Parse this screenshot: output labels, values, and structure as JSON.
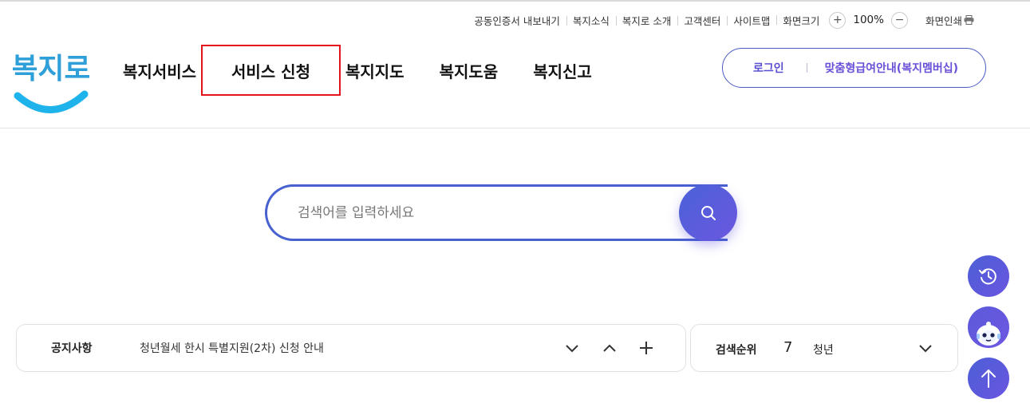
{
  "utility": {
    "cert_export": "공동인증서 내보내기",
    "news": "복지소식",
    "about": "복지로 소개",
    "customer": "고객센터",
    "sitemap": "사이트맵",
    "screen_size": "화면크기",
    "zoom_plus": "+",
    "zoom_value": "100%",
    "zoom_minus": "−",
    "print": "화면인쇄"
  },
  "logo": {
    "text": "복지로"
  },
  "nav": {
    "items": [
      {
        "label": "복지서비스"
      },
      {
        "label": "서비스 신청"
      },
      {
        "label": "복지지도"
      },
      {
        "label": "복지도움"
      },
      {
        "label": "복지신고"
      }
    ]
  },
  "auth": {
    "login": "로그인",
    "membership": "맞춤형급여안내(복지멤버십)"
  },
  "search": {
    "placeholder": "검색어를 입력하세요"
  },
  "notice": {
    "title": "공지사항",
    "text": "청년월세 한시 특별지원(2차) 신청 안내"
  },
  "ranking": {
    "title": "검색순위",
    "number": "7",
    "keyword": "청년"
  },
  "colors": {
    "brand_blue": "#4761d0",
    "brand_purple": "#6a4fd8",
    "highlight_red": "#e5141a"
  },
  "icons": {
    "search": "search-icon",
    "history": "history-icon",
    "chatbot": "chatbot-icon",
    "scroll_top": "arrow-up-icon",
    "print": "printer-icon"
  }
}
